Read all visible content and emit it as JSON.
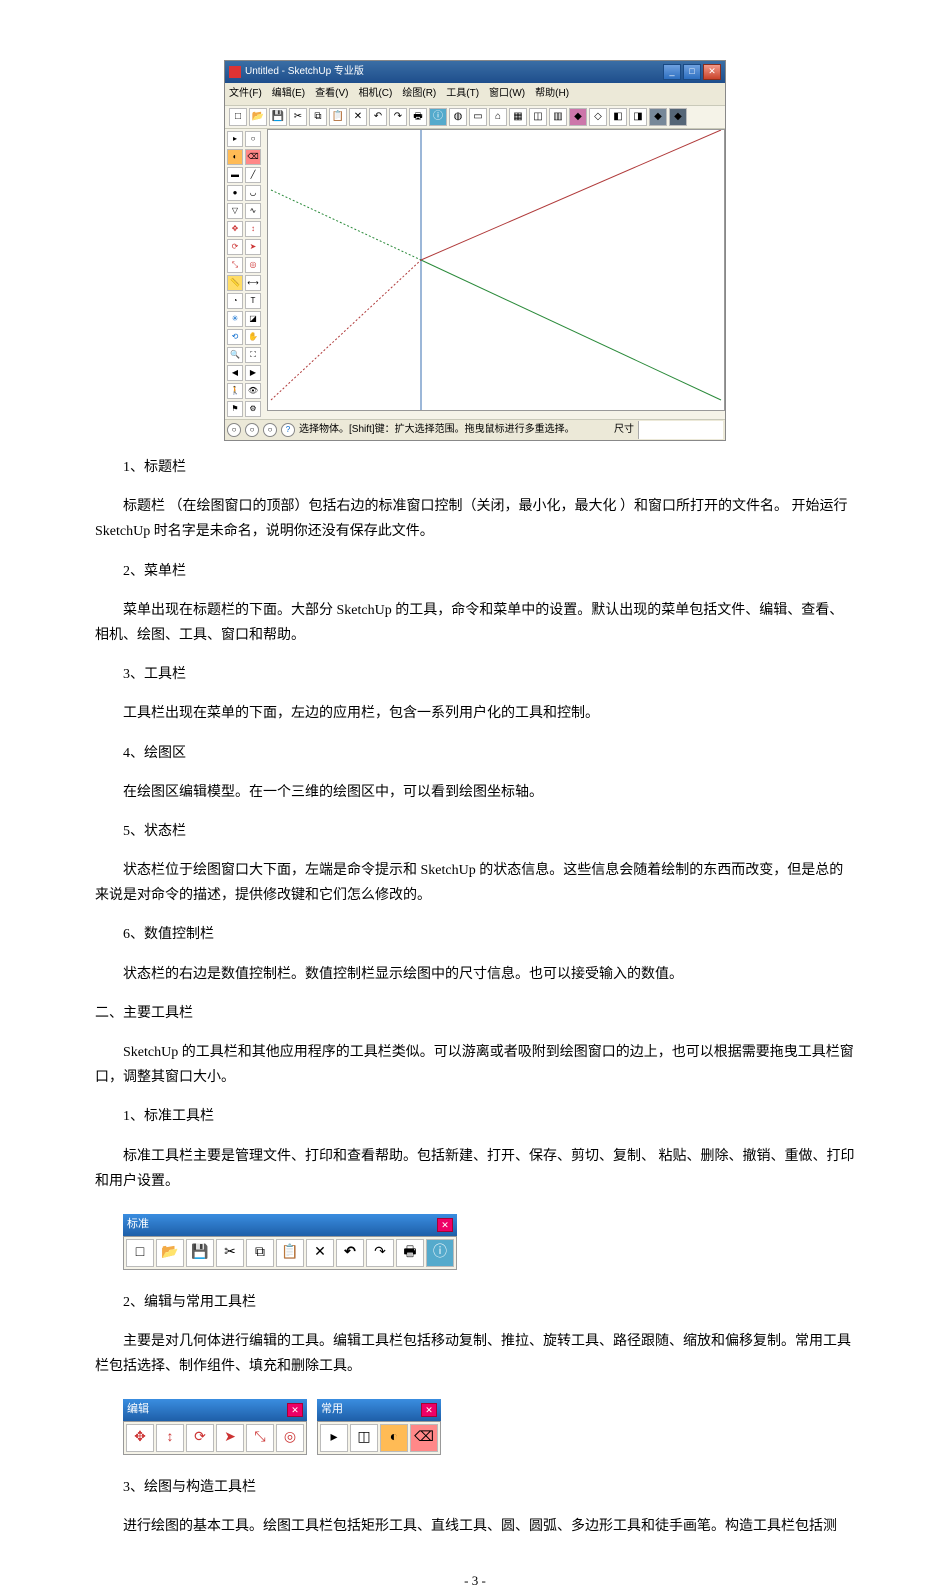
{
  "screenshot": {
    "title": "Untitled - SketchUp 专业版",
    "menus": [
      "文件(F)",
      "编辑(E)",
      "查看(V)",
      "相机(C)",
      "绘图(R)",
      "工具(T)",
      "窗口(W)",
      "帮助(H)"
    ],
    "status_tip": "选择物体。[Shift]键：扩大选择范围。拖曳鼠标进行多重选择。",
    "dim_label": "尺寸"
  },
  "sections": [
    {
      "num": "1、标题栏",
      "body": "标题栏 （在绘图窗口的顶部）包括右边的标准窗口控制（关闭，最小化，最大化 ）和窗口所打开的文件名。 开始运行 SketchUp 时名字是未命名，说明你还没有保存此文件。"
    },
    {
      "num": "2、菜单栏",
      "body": "菜单出现在标题栏的下面。大部分 SketchUp 的工具，命令和菜单中的设置。默认出现的菜单包括文件、编辑、查看、相机、绘图、工具、窗口和帮助。"
    },
    {
      "num": "3、工具栏",
      "body": "工具栏出现在菜单的下面，左边的应用栏，包含一系列用户化的工具和控制。"
    },
    {
      "num": "4、绘图区",
      "body": "在绘图区编辑模型。在一个三维的绘图区中，可以看到绘图坐标轴。"
    },
    {
      "num": "5、状态栏",
      "body": "状态栏位于绘图窗口大下面，左端是命令提示和 SketchUp 的状态信息。这些信息会随着绘制的东西而改变，但是总的来说是对命令的描述，提供修改键和它们怎么修改的。"
    },
    {
      "num": "6、数值控制栏",
      "body": "状态栏的右边是数值控制栏。数值控制栏显示绘图中的尺寸信息。也可以接受输入的数值。"
    }
  ],
  "heading2": "二、主要工具栏",
  "heading2_body": "SketchUp 的工具栏和其他应用程序的工具栏类似。可以游离或者吸附到绘图窗口的边上，也可以根据需要拖曳工具栏窗口，调整其窗口大小。",
  "sub": [
    {
      "num": "1、标准工具栏",
      "body": "标准工具栏主要是管理文件、打印和查看帮助。包括新建、打开、保存、剪切、复制、 粘贴、删除、撤销、重做、打印和用户设置。"
    },
    {
      "num": "2、编辑与常用工具栏",
      "body": "主要是对几何体进行编辑的工具。编辑工具栏包括移动复制、推拉、旋转工具、路径跟随、缩放和偏移复制。常用工具栏包括选择、制作组件、填充和删除工具。"
    },
    {
      "num": "3、绘图与构造工具栏",
      "body": "进行绘图的基本工具。绘图工具栏包括矩形工具、直线工具、圆、圆弧、多边形工具和徒手画笔。构造工具栏包括测"
    }
  ],
  "toolbar_labels": {
    "standard": "标准",
    "edit": "编辑",
    "common": "常用"
  },
  "page_number": "- 3 -"
}
